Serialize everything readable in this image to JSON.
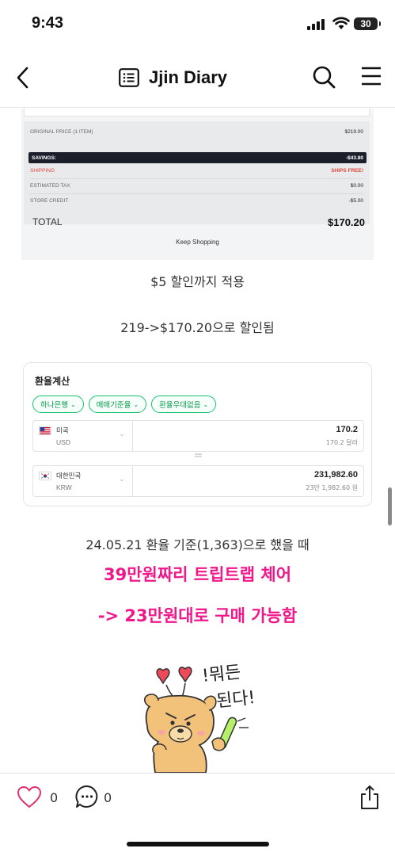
{
  "status_bar": {
    "time": "9:43",
    "battery": "30"
  },
  "nav": {
    "title": "Jjin Diary"
  },
  "receipt": {
    "rows": [
      {
        "label": "ORIGINAL PRICE (1 ITEM)",
        "value": "$219.00"
      },
      {
        "label": "SAVINGS:",
        "value": "-$43.80"
      },
      {
        "label": "SHIPPING",
        "value": "SHIPS FREE!"
      },
      {
        "label": "ESTIMATED TAX",
        "value": "$0.00"
      },
      {
        "label": "STORE CREDIT",
        "value": "-$5.00"
      }
    ],
    "total_label": "TOTAL",
    "total_value": "$170.20",
    "keep_shopping": "Keep Shopping"
  },
  "captions": {
    "discount": "$5 할인까지 적용",
    "result": "219->$170.20으로 할인됨",
    "rate_note": "24.05.21 환율 기준(1,363)으로 했을 때"
  },
  "exchange": {
    "title": "환율계산",
    "chips": [
      "하나은행",
      "매매기준율",
      "환율우대없음"
    ],
    "from": {
      "country": "미국",
      "code": "USD",
      "amount": "170.2",
      "amount_sub": "170.2 달러"
    },
    "to": {
      "country": "대한민국",
      "code": "KRW",
      "amount": "231,982.60",
      "amount_sub": "23만 1,982.60 원"
    },
    "equals": "="
  },
  "highlights": {
    "line1": "39만원짜리 트립트랩 체어",
    "line2": "-> 23만원대로 구매 가능함"
  },
  "sticker": {
    "text1": "!뭐든",
    "text2": "된다!"
  },
  "bottom_bar": {
    "like_count": "0",
    "comment_count": "0"
  },
  "colors": {
    "highlight": "#f0178a",
    "chip_green": "#19c36b",
    "savings_bar": "#1b1f2a",
    "shipping_red": "#e0483e"
  }
}
